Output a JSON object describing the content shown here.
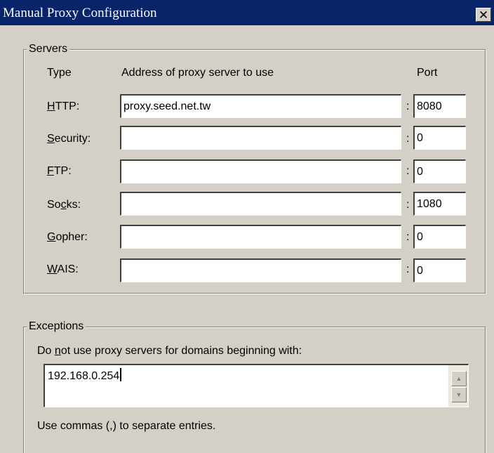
{
  "window": {
    "title": "Manual Proxy Configuration",
    "close_glyph": "✕"
  },
  "servers": {
    "legend": "Servers",
    "col_type": "Type",
    "col_address": "Address of proxy server to use",
    "col_port": "Port",
    "separator": ":",
    "rows": [
      {
        "label_pre": "",
        "accel": "H",
        "label_post": "TTP:",
        "address": "proxy.seed.net.tw",
        "port": "8080"
      },
      {
        "label_pre": "",
        "accel": "S",
        "label_post": "ecurity:",
        "address": "",
        "port": "0"
      },
      {
        "label_pre": "",
        "accel": "F",
        "label_post": "TP:",
        "address": "",
        "port": "0"
      },
      {
        "label_pre": "So",
        "accel": "c",
        "label_post": "ks:",
        "address": "",
        "port": "1080"
      },
      {
        "label_pre": "",
        "accel": "G",
        "label_post": "opher:",
        "address": "",
        "port": "0"
      },
      {
        "label_pre": "",
        "accel": "W",
        "label_post": "AIS:",
        "address": "",
        "port": "0"
      }
    ]
  },
  "exceptions": {
    "legend": "Exceptions",
    "desc_pre": "Do ",
    "desc_accel": "n",
    "desc_post": "ot use proxy servers for domains beginning with:",
    "value": "192.168.0.254",
    "hint": "Use commas (,) to separate entries.",
    "scroll_up_glyph": "▲",
    "scroll_down_glyph": "▼"
  }
}
